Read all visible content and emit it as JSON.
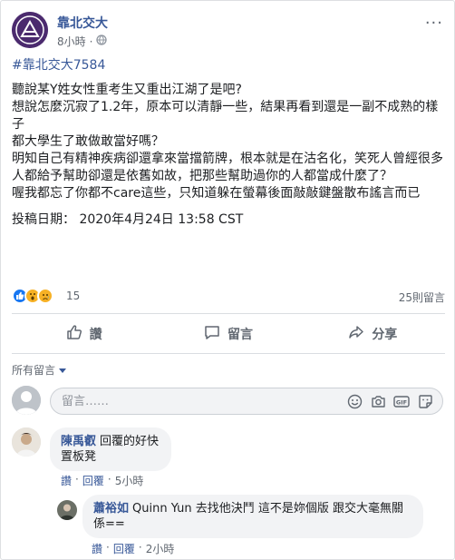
{
  "post": {
    "page_name": "靠北交大",
    "time": "8小時",
    "dot": "·",
    "hashtag": "#靠北交大7584",
    "paragraphs": [
      "聽說某Y姓女性重考生又重出江湖了是吧?",
      "想說怎麼沉寂了1.2年，原本可以清靜一些，結果再看到還是一副不成熟的樣子",
      "都大學生了敢做敢當好嗎？",
      "明知自己有精神疾病卻還拿來當擋箭牌，根本就是在沽名化，笑死人曾經很多人都給予幫助卻還是依舊如故，把那些幫助過你的人都當成什麼了？",
      "喔我都忘了你都不care這些，只知道躲在螢幕後面敲敲鍵盤散布謠言而已"
    ],
    "post_date": "投稿日期： 2020年4月24日 13:58 CST"
  },
  "reactions": {
    "count": "15",
    "comments_count": "25則留言"
  },
  "actions": {
    "like": "讚",
    "comment": "留言",
    "share": "分享"
  },
  "comments_filter": "所有留言",
  "composer": {
    "placeholder": "留言……"
  },
  "comments": [
    {
      "author": "陳禹叡",
      "text": "回覆的好快 置板凳",
      "like": "讚",
      "reply": "回覆",
      "time": "5小時"
    },
    {
      "author": "蕭裕如",
      "text": "Quinn Yun 去找他決鬥 這不是妳個版 跟交大毫無關係==",
      "like": "讚",
      "reply": "回覆",
      "time": "2小時"
    }
  ],
  "colors": {
    "link": "#385898",
    "like_blue": "#1877f2",
    "muted": "#606770"
  }
}
